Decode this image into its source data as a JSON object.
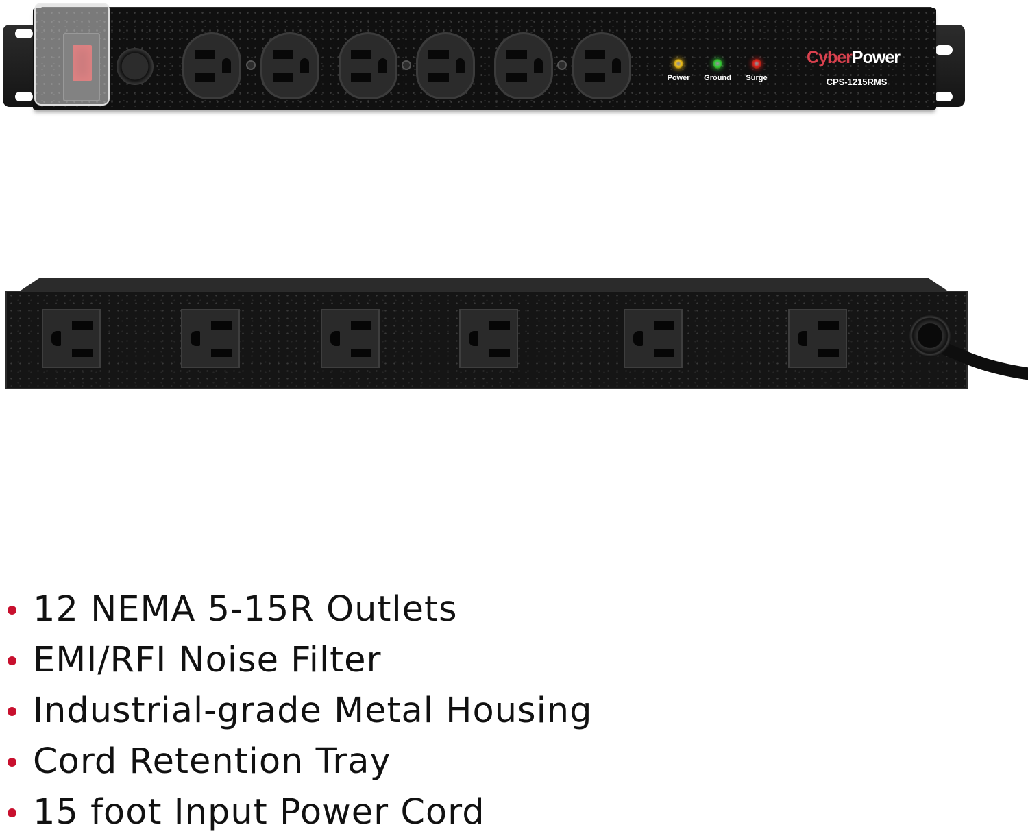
{
  "front_unit": {
    "brand_part1": "Cyber",
    "brand_part2": "Power",
    "model": "CPS-1215RMS",
    "indicators": [
      {
        "label": "Power",
        "color": "#f2c21b"
      },
      {
        "label": "Ground",
        "color": "#2fd13a"
      },
      {
        "label": "Surge",
        "color": "#e0201e"
      }
    ],
    "outlet_count": 6
  },
  "rear_unit": {
    "outlet_count": 6
  },
  "features": [
    "12 NEMA 5-15R Outlets",
    "EMI/RFI Noise Filter",
    "Industrial-grade Metal Housing",
    "Cord Retention Tray",
    "15 foot Input Power Cord"
  ],
  "colors": {
    "bullet": "#c8102e",
    "brand_accent": "#d9414e",
    "switch_light": "#c41418"
  }
}
